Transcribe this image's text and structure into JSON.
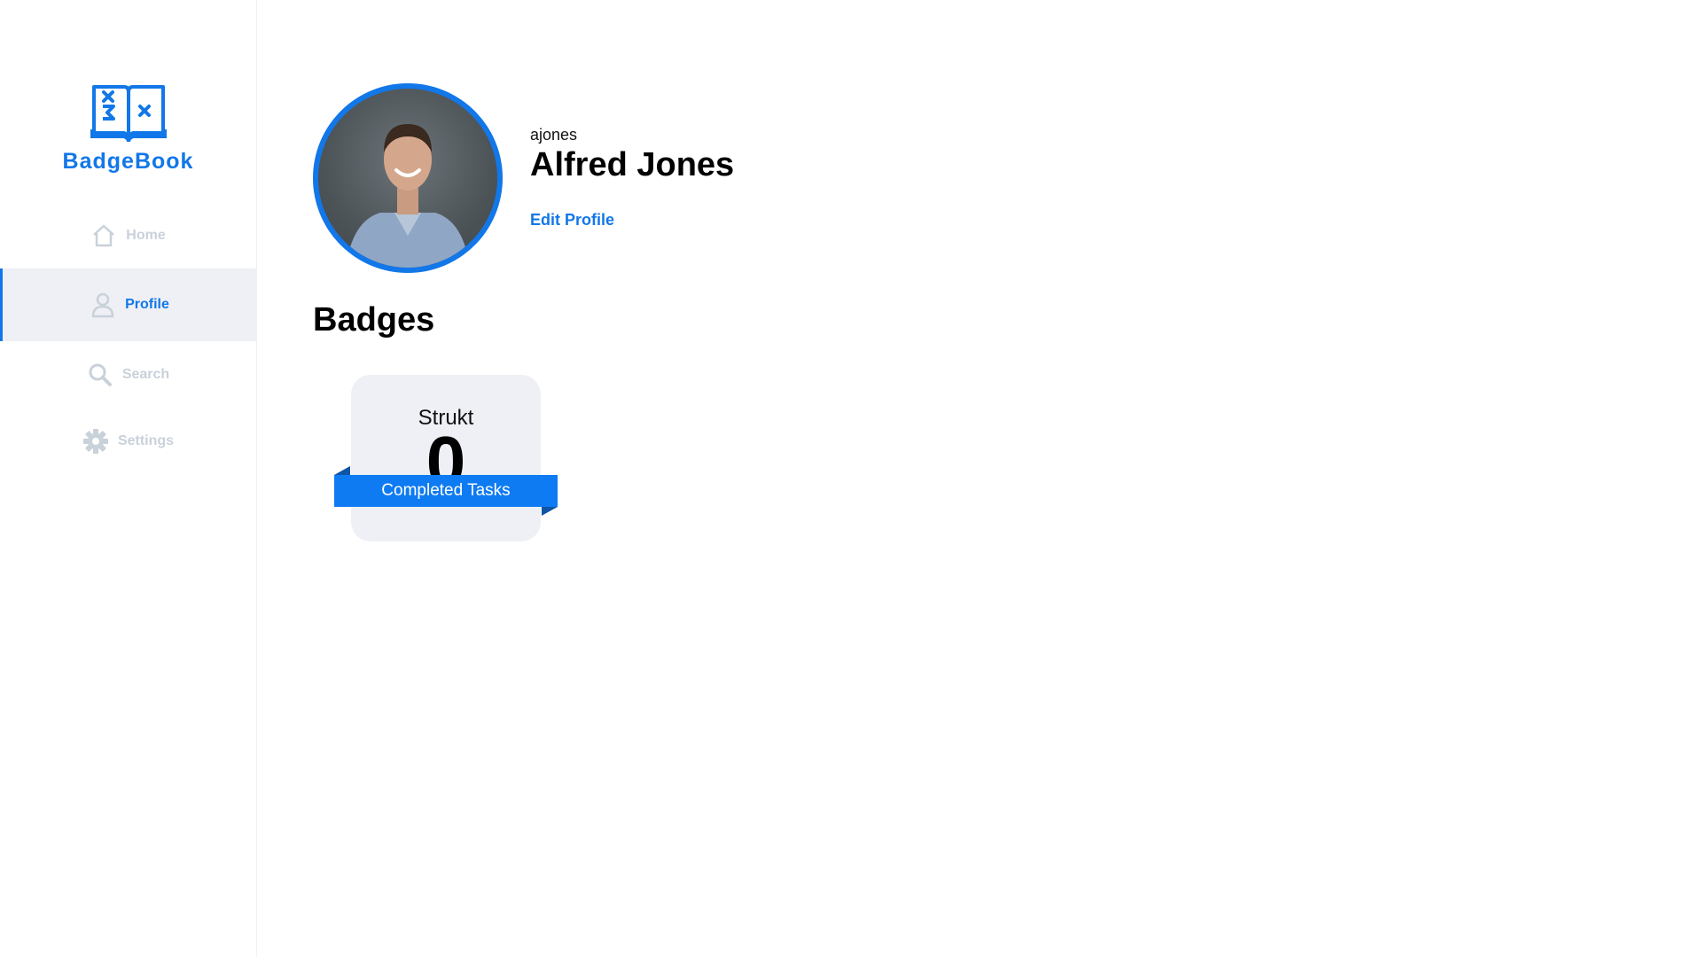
{
  "brand": {
    "name": "BadgeBook",
    "color": "#1277e8"
  },
  "nav": {
    "items": [
      {
        "label": "Home",
        "icon": "home-icon",
        "active": false
      },
      {
        "label": "Profile",
        "icon": "user-icon",
        "active": true
      },
      {
        "label": "Search",
        "icon": "search-icon",
        "active": false
      },
      {
        "label": "Settings",
        "icon": "gear-icon",
        "active": false
      }
    ]
  },
  "profile": {
    "username": "ajones",
    "full_name": "Alfred Jones",
    "edit_label": "Edit Profile",
    "avatar": "profile-photo"
  },
  "badges": {
    "title": "Badges",
    "items": [
      {
        "name": "Strukt",
        "count": "0",
        "ribbon_label": "Completed Tasks"
      }
    ]
  },
  "colors": {
    "accent": "#1277e8",
    "nav_inactive": "#c9d1da",
    "card_background": "#eef0f5",
    "ribbon_dark": "#0f55a8"
  }
}
